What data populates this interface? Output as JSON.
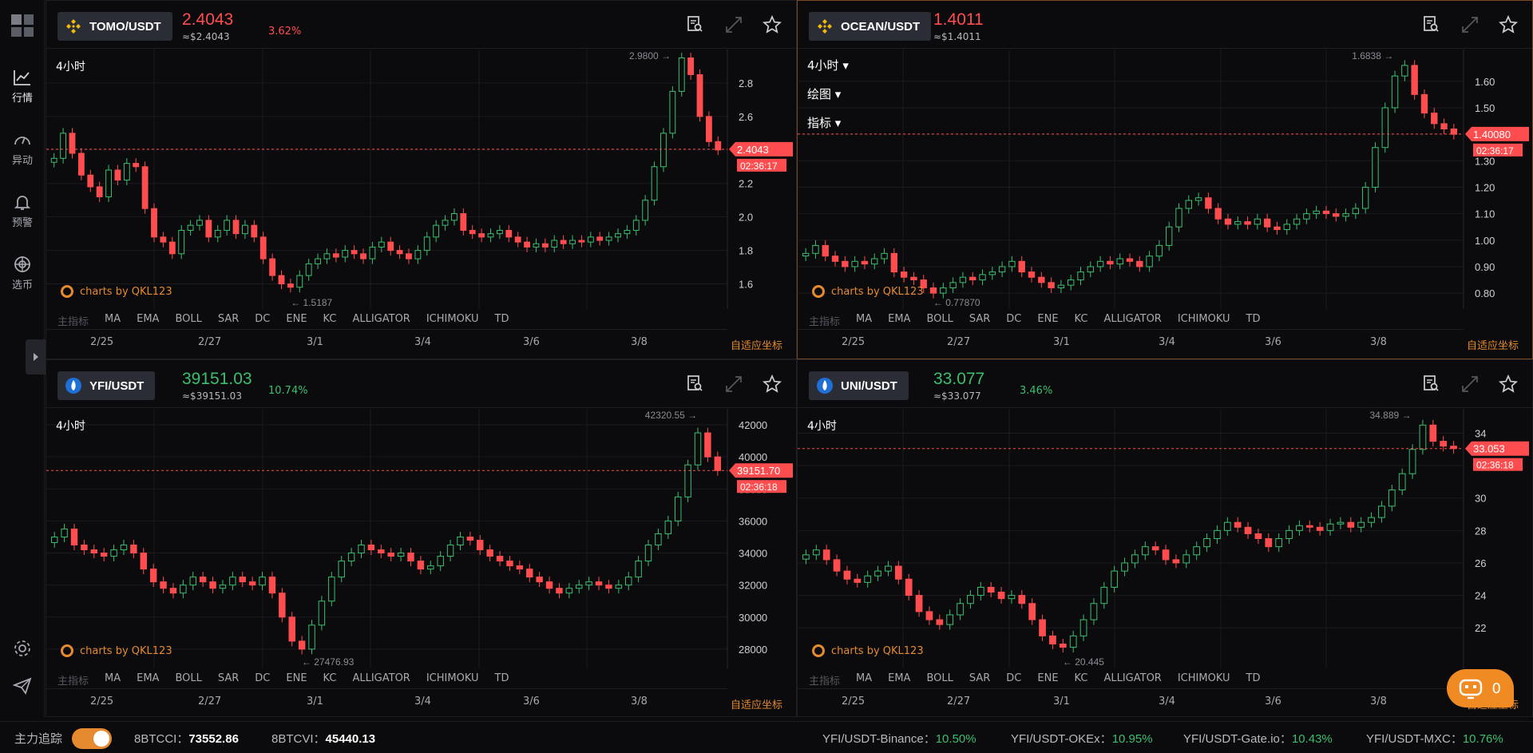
{
  "sidebar": {
    "items": [
      {
        "label": "行情",
        "icon": "line-chart-icon"
      },
      {
        "label": "异动",
        "icon": "gauge-icon"
      },
      {
        "label": "预警",
        "icon": "bell-icon"
      },
      {
        "label": "选币",
        "icon": "target-icon"
      }
    ]
  },
  "common": {
    "timeframe": "4小时",
    "draw": "绘图",
    "indicator": "指标",
    "watermark": "charts by QKL123",
    "indicators": [
      "主指标",
      "MA",
      "EMA",
      "BOLL",
      "SAR",
      "DC",
      "ENE",
      "KC",
      "ALLIGATOR",
      "ICHIMOKU",
      "TD"
    ],
    "dates": [
      "2/25",
      "2/27",
      "3/1",
      "3/4",
      "3/6",
      "3/8"
    ],
    "auto_axis": "自适应坐标"
  },
  "panels": [
    {
      "pair": "TOMO/USDT",
      "exchange": "binance",
      "price": "2.4043",
      "usd": "≈$2.4043",
      "change": "3.62%",
      "dir": "down",
      "chart_data": {
        "type": "candlestick",
        "y_ticks": [
          "2.8",
          "2.6",
          "2.4",
          "2.2",
          "2.0",
          "1.8",
          "1.6"
        ],
        "ylim": [
          1.45,
          3.0
        ],
        "high_label": "2.9800",
        "low_label": "1.5187",
        "last_price": "2.4043",
        "countdown": "02:36:17",
        "series": [
          2.35,
          2.5,
          2.38,
          2.25,
          2.18,
          2.12,
          2.28,
          2.22,
          2.32,
          2.3,
          2.05,
          1.88,
          1.85,
          1.78,
          1.92,
          1.95,
          1.98,
          1.88,
          1.92,
          1.98,
          1.9,
          1.95,
          1.88,
          1.75,
          1.65,
          1.6,
          1.58,
          1.65,
          1.72,
          1.75,
          1.78,
          1.76,
          1.8,
          1.78,
          1.75,
          1.82,
          1.85,
          1.8,
          1.78,
          1.75,
          1.8,
          1.88,
          1.95,
          1.98,
          2.02,
          1.92,
          1.9,
          1.88,
          1.9,
          1.92,
          1.88,
          1.85,
          1.82,
          1.84,
          1.82,
          1.86,
          1.84,
          1.86,
          1.85,
          1.88,
          1.86,
          1.88,
          1.9,
          1.92,
          1.98,
          2.1,
          2.3,
          2.5,
          2.75,
          2.95,
          2.85,
          2.6,
          2.45,
          2.4
        ]
      }
    },
    {
      "pair": "OCEAN/USDT",
      "exchange": "binance",
      "price": "1.4011",
      "usd": "≈$1.4011",
      "change": "",
      "dir": "down",
      "chart_data": {
        "type": "candlestick",
        "y_ticks": [
          "1.60",
          "1.50",
          "1.40",
          "1.30",
          "1.20",
          "1.10",
          "1.00",
          "0.90",
          "0.80"
        ],
        "ylim": [
          0.74,
          1.72
        ],
        "high_label": "1.6838",
        "low_label": "0.77870",
        "last_price": "1.40080",
        "countdown": "02:36:17",
        "series": [
          0.95,
          0.98,
          0.94,
          0.92,
          0.9,
          0.92,
          0.91,
          0.93,
          0.95,
          0.88,
          0.86,
          0.85,
          0.82,
          0.8,
          0.82,
          0.84,
          0.86,
          0.85,
          0.87,
          0.88,
          0.9,
          0.92,
          0.88,
          0.86,
          0.84,
          0.82,
          0.83,
          0.85,
          0.88,
          0.9,
          0.92,
          0.91,
          0.93,
          0.92,
          0.9,
          0.94,
          0.98,
          1.05,
          1.12,
          1.15,
          1.16,
          1.12,
          1.08,
          1.06,
          1.07,
          1.06,
          1.08,
          1.05,
          1.04,
          1.06,
          1.08,
          1.1,
          1.11,
          1.1,
          1.09,
          1.1,
          1.12,
          1.2,
          1.35,
          1.5,
          1.62,
          1.66,
          1.55,
          1.48,
          1.44,
          1.42,
          1.4
        ]
      }
    },
    {
      "pair": "YFI/USDT",
      "exchange": "huobi",
      "price": "39151.03",
      "usd": "≈$39151.03",
      "change": "10.74%",
      "dir": "up",
      "chart_data": {
        "type": "candlestick",
        "y_ticks": [
          "42000",
          "40000",
          "38000",
          "36000",
          "34000",
          "32000",
          "30000",
          "28000"
        ],
        "ylim": [
          26800,
          43000
        ],
        "high_label": "42320.55",
        "low_label": "27476.93",
        "last_price": "39151.70",
        "countdown": "02:36:18",
        "series": [
          35000,
          35500,
          34500,
          34200,
          34000,
          33800,
          34200,
          34500,
          34000,
          33000,
          32200,
          31800,
          31500,
          32000,
          32500,
          32200,
          31800,
          32000,
          32500,
          32200,
          32000,
          32500,
          31500,
          30000,
          28500,
          28000,
          29500,
          31000,
          32500,
          33500,
          34000,
          34500,
          34200,
          34000,
          33800,
          34000,
          33500,
          33000,
          33200,
          33800,
          34500,
          35000,
          34800,
          34200,
          33800,
          33500,
          33200,
          33000,
          32500,
          32200,
          31800,
          31500,
          31800,
          32000,
          32200,
          32000,
          31800,
          32000,
          32500,
          33500,
          34500,
          35200,
          36000,
          37500,
          39500,
          41500,
          40000,
          39150
        ]
      }
    },
    {
      "pair": "UNI/USDT",
      "exchange": "uniswap",
      "price": "33.077",
      "usd": "≈$33.077",
      "change": "3.46%",
      "dir": "up",
      "chart_data": {
        "type": "candlestick",
        "y_ticks": [
          "34",
          "32",
          "30",
          "28",
          "26",
          "24",
          "22"
        ],
        "ylim": [
          19.5,
          35.5
        ],
        "high_label": "34.889",
        "low_label": "20.445",
        "last_price": "33.053",
        "countdown": "02:36:18",
        "series": [
          26.5,
          26.8,
          26.2,
          25.5,
          25,
          24.8,
          25.2,
          25.5,
          25.8,
          25,
          24,
          23,
          22.5,
          22.2,
          22.8,
          23.5,
          24,
          24.5,
          24.2,
          23.8,
          24,
          23.5,
          22.5,
          21.5,
          21,
          20.8,
          21.5,
          22.5,
          23.5,
          24.5,
          25.5,
          26,
          26.5,
          27,
          26.8,
          26.2,
          26,
          26.5,
          27,
          27.5,
          28,
          28.5,
          28.2,
          27.8,
          27.5,
          27,
          27.5,
          28,
          28.3,
          28.2,
          28,
          28.4,
          28.5,
          28.2,
          28.5,
          28.8,
          29.5,
          30.5,
          31.5,
          33,
          34.5,
          33.5,
          33.2,
          33.05
        ]
      }
    }
  ],
  "bottom": {
    "track_label": "主力追踪",
    "btcci_label": "8BTCCI：",
    "btcci_value": "73552.86",
    "btcvi_label": "8BTCVI：",
    "btcvi_value": "45440.13",
    "tickers": [
      {
        "label": "YFI/USDT-Binance：",
        "value": "10.50%"
      },
      {
        "label": "YFI/USDT-OKEx：",
        "value": "10.95%"
      },
      {
        "label": "YFI/USDT-Gate.io：",
        "value": "10.43%"
      },
      {
        "label": "YFI/USDT-MXC：",
        "value": "10.76%"
      }
    ],
    "chat_count": "0"
  }
}
